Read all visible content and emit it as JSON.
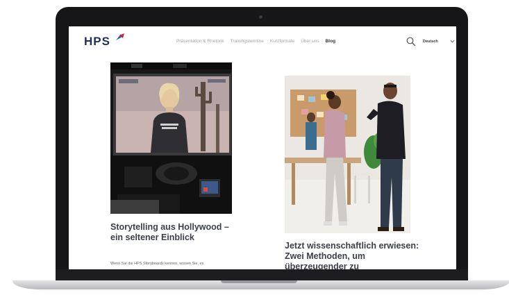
{
  "header": {
    "logo": "HPS",
    "nav": [
      {
        "label": "Präsentation & Rhetorik"
      },
      {
        "label": "Trainingstermine"
      },
      {
        "label": "Kurzformate"
      },
      {
        "label": "Über uns"
      },
      {
        "label": "Blog"
      }
    ],
    "active_nav": "Blog",
    "language": "Deutsch"
  },
  "articles": [
    {
      "title": "Storytelling aus Hollywood – ein seltener Einblick",
      "excerpt": "Wenn Sie die HPS Storyboards kennen, wissen Sie, es"
    },
    {
      "title": "Jetzt wissenschaftlich erwiesen: Zwei Methoden, um überzeugender zu",
      "excerpt": ""
    }
  ],
  "colors": {
    "logo": "#1f2f5c",
    "logo_red": "#d2232a",
    "logo_blue": "#1d5fb8",
    "title": "#3b3f47"
  }
}
